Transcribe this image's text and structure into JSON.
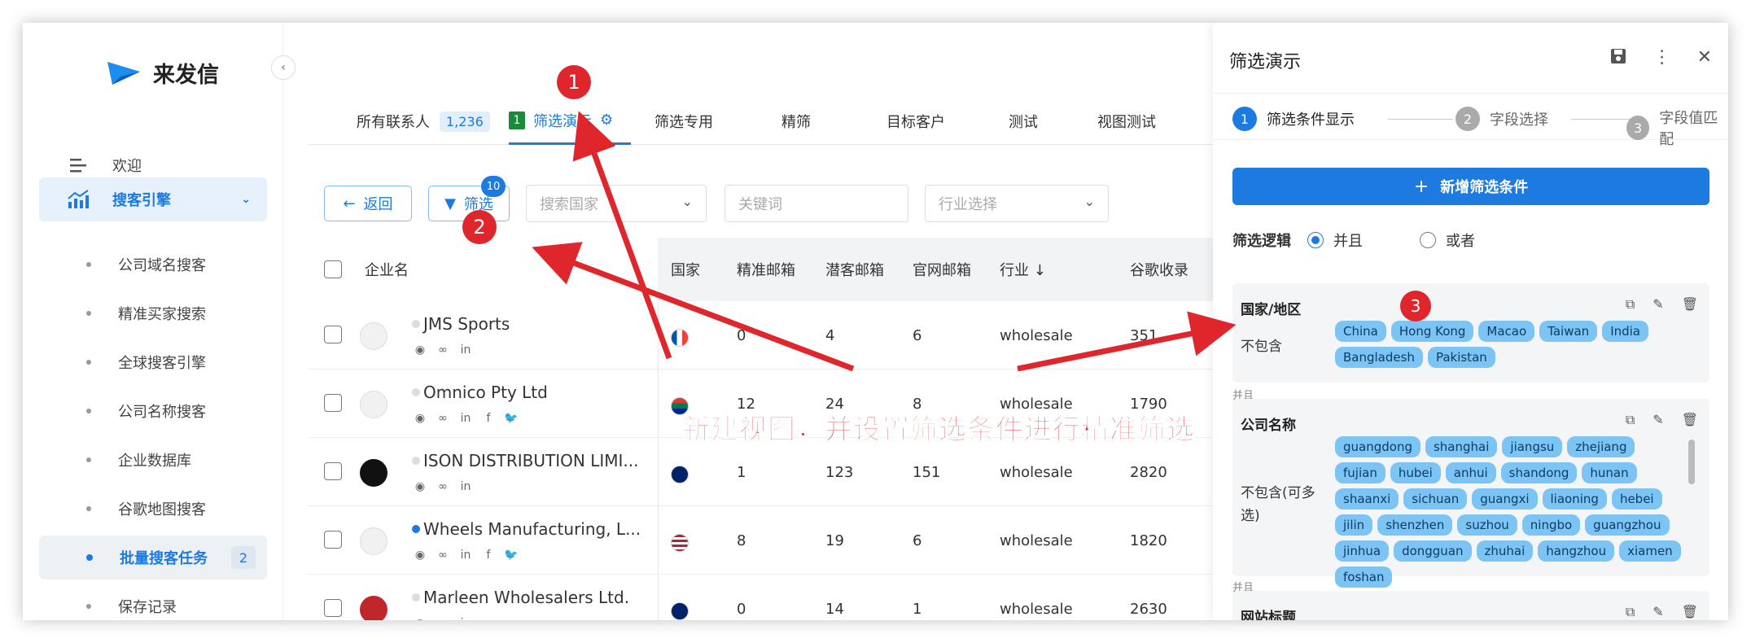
{
  "app": {
    "logo_text": "来发信"
  },
  "sidebar": {
    "items": [
      {
        "label": "欢迎"
      },
      {
        "label": "搜客引擎"
      },
      {
        "label": "公司域名搜客"
      },
      {
        "label": "精准买家搜索"
      },
      {
        "label": "全球搜客引擎"
      },
      {
        "label": "公司名称搜客"
      },
      {
        "label": "企业数据库"
      },
      {
        "label": "谷歌地图搜客"
      },
      {
        "label": "批量搜客任务",
        "badge": "2"
      },
      {
        "label": "保存记录"
      }
    ]
  },
  "tabs": [
    {
      "label": "所有联系人",
      "count": "1,236"
    },
    {
      "num": "1",
      "label": "筛选演示"
    },
    {
      "label": "筛选专用"
    },
    {
      "label": "精筛"
    },
    {
      "label": "目标客户"
    },
    {
      "label": "测试"
    },
    {
      "label": "视图测试"
    }
  ],
  "toolbar": {
    "back_label": "返回",
    "filter_label": "筛选",
    "filter_badge": "10",
    "country_placeholder": "搜索国家",
    "keyword_placeholder": "关键词",
    "industry_placeholder": "行业选择"
  },
  "table": {
    "headers": [
      "企业名",
      "国家",
      "精准邮箱",
      "潜客邮箱",
      "官网邮箱",
      "行业 ↓",
      "谷歌收录"
    ],
    "rows": [
      {
        "name": "JMS Sports",
        "precise": "0",
        "potential": "4",
        "site": "6",
        "industry": "wholesale",
        "google": "351",
        "online": false
      },
      {
        "name": "Omnico Pty Ltd",
        "precise": "12",
        "potential": "24",
        "site": "8",
        "industry": "wholesale",
        "google": "1790",
        "online": false
      },
      {
        "name": "ISON DISTRIBUTION LIMI...",
        "precise": "1",
        "potential": "123",
        "site": "151",
        "industry": "wholesale",
        "google": "2820",
        "online": false
      },
      {
        "name": "Wheels Manufacturing, L...",
        "precise": "8",
        "potential": "19",
        "site": "6",
        "industry": "wholesale",
        "google": "1820",
        "online": true
      },
      {
        "name": "Marleen Wholesalers Ltd.",
        "precise": "0",
        "potential": "14",
        "site": "1",
        "industry": "wholesale",
        "google": "2630",
        "online": false
      }
    ]
  },
  "panel": {
    "title": "筛选演示",
    "steps": [
      {
        "num": "1",
        "label": "筛选条件显示"
      },
      {
        "num": "2",
        "label": "字段选择"
      },
      {
        "num": "3",
        "label": "字段值匹配"
      }
    ],
    "add_label": "新增筛选条件",
    "logic_label": "筛选逻辑",
    "logic_and": "并且",
    "logic_or": "或者",
    "and_separator": "并且",
    "cards": [
      {
        "title": "国家/地区",
        "op": "不包含",
        "chips": [
          "China",
          "Hong Kong",
          "Macao",
          "Taiwan",
          "India",
          "Bangladesh",
          "Pakistan"
        ]
      },
      {
        "title": "公司名称",
        "op": "不包含(可多选)",
        "chips": [
          "guangdong",
          "shanghai",
          "jiangsu",
          "zhejiang",
          "fujian",
          "hubei",
          "anhui",
          "shandong",
          "hunan",
          "shaanxi",
          "sichuan",
          "guangxi",
          "liaoning",
          "hebei",
          "jilin",
          "shenzhen",
          "suzhou",
          "ningbo",
          "guangzhou",
          "jinhua",
          "dongguan",
          "zhuhai",
          "hangzhou",
          "xiamen",
          "foshan"
        ]
      },
      {
        "title": "网站标题"
      }
    ]
  },
  "annotations": {
    "markers": [
      "1",
      "2",
      "3"
    ],
    "banner": "新建视图，并设置筛选条件进行精准筛选"
  },
  "colors": {
    "accent": "#1c7ae0",
    "annotation": "#e0262d",
    "chip": "#7cc4f4"
  }
}
